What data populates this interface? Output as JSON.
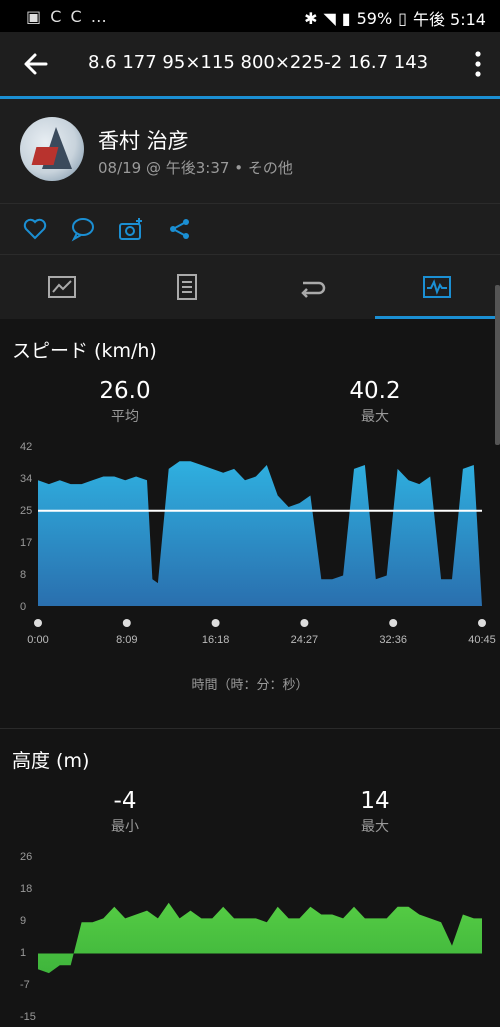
{
  "status": {
    "left_icons": "▣ C C …",
    "battery": "59%",
    "time": "午後 5:14"
  },
  "appbar": {
    "title": "8.6  177  95×115  800×225-2  16.7  143"
  },
  "profile": {
    "name": "香村 治彦",
    "meta": "08/19 @ 午後3:37 • その他"
  },
  "actions": [
    "heart-icon",
    "comment-icon",
    "add-photo-icon",
    "share-icon"
  ],
  "tabs": [
    "stats-tab",
    "details-tab",
    "laps-tab",
    "charts-tab"
  ],
  "colors": {
    "accent": "#1b8fd3",
    "speed_fill": "#2aa6d8",
    "elev_fill": "#4cc24a"
  },
  "speed": {
    "title": "スピード (km/h)",
    "avg_value": "26.0",
    "avg_label": "平均",
    "max_value": "40.2",
    "max_label": "最大",
    "xaxis_label": "時間（時：分：秒）"
  },
  "elevation": {
    "title": "高度 (m)",
    "min_value": "-4",
    "min_label": "最小",
    "max_value": "14",
    "max_label": "最大"
  },
  "chart_data": [
    {
      "type": "area",
      "title": "スピード (km/h)",
      "xlabel": "時間（時：分：秒）",
      "ylim": [
        0,
        42
      ],
      "yticks": [
        "42",
        "34",
        "25",
        "17",
        "8",
        "0"
      ],
      "xticks": [
        "0:00",
        "8:09",
        "16:18",
        "24:27",
        "32:36",
        "40:45"
      ],
      "reference_line": 25,
      "series": [
        {
          "x": [
            0,
            1,
            2,
            3,
            4,
            5,
            6,
            7,
            8,
            9,
            10,
            10.5,
            11,
            12,
            13,
            14,
            15,
            16,
            17,
            18,
            19,
            20,
            21,
            22,
            23,
            24,
            25,
            26,
            27,
            28,
            29,
            30,
            31,
            32,
            33,
            34,
            35,
            36,
            37,
            38,
            39,
            40,
            40.75
          ],
          "values": [
            33,
            32,
            33,
            32,
            32,
            33,
            34,
            34,
            33,
            34,
            33,
            7,
            6,
            36,
            38,
            38,
            37,
            36,
            35,
            36,
            33,
            34,
            37,
            29,
            26,
            27,
            29,
            7,
            7,
            8,
            36,
            37,
            7,
            8,
            36,
            33,
            32,
            34,
            7,
            7,
            36,
            37,
            0
          ]
        }
      ]
    },
    {
      "type": "area",
      "title": "高度 (m)",
      "ylim": [
        -15,
        26
      ],
      "yticks": [
        "26",
        "18",
        "9",
        "1",
        "-7",
        "-15"
      ],
      "series": [
        {
          "x": [
            0,
            1,
            2,
            3,
            4,
            5,
            6,
            7,
            8,
            9,
            10,
            11,
            12,
            13,
            14,
            15,
            16,
            17,
            18,
            19,
            20,
            21,
            22,
            23,
            24,
            25,
            26,
            27,
            28,
            29,
            30,
            31,
            32,
            33,
            34,
            35,
            36,
            37,
            38,
            39,
            40,
            40.75
          ],
          "values": [
            -3,
            -4,
            -2,
            -2,
            9,
            9,
            10,
            13,
            10,
            11,
            12,
            10,
            14,
            10,
            12,
            10,
            10,
            13,
            10,
            10,
            10,
            9,
            13,
            10,
            10,
            13,
            11,
            11,
            10,
            13,
            10,
            10,
            10,
            13,
            13,
            11,
            10,
            9,
            3,
            11,
            10,
            10
          ]
        }
      ]
    }
  ]
}
